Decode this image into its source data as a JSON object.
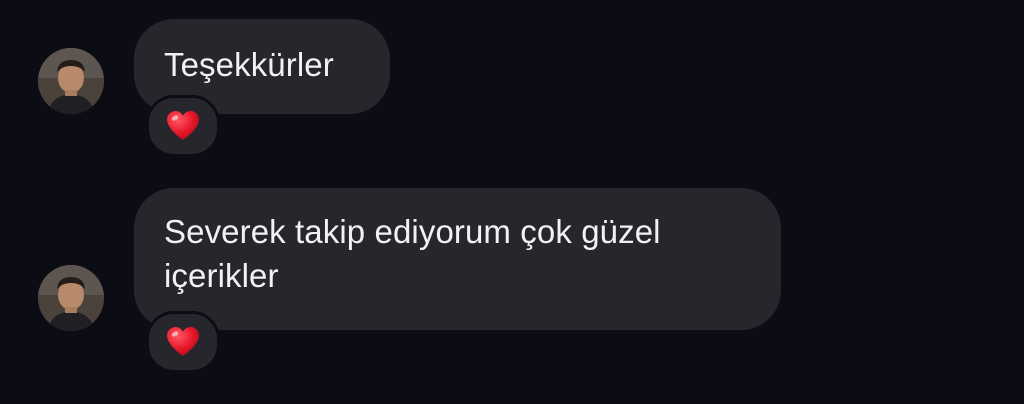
{
  "messages": [
    {
      "text": "Teşekkürler",
      "reaction": "heart-emoji",
      "avatar": "user-avatar"
    },
    {
      "text": "Severek takip ediyorum çok güzel içerikler",
      "reaction": "heart-emoji",
      "avatar": "user-avatar"
    }
  ],
  "colors": {
    "background": "#0c0d14",
    "bubble": "#26272d",
    "text": "#f2f2f5",
    "heart": "#e8182a"
  }
}
